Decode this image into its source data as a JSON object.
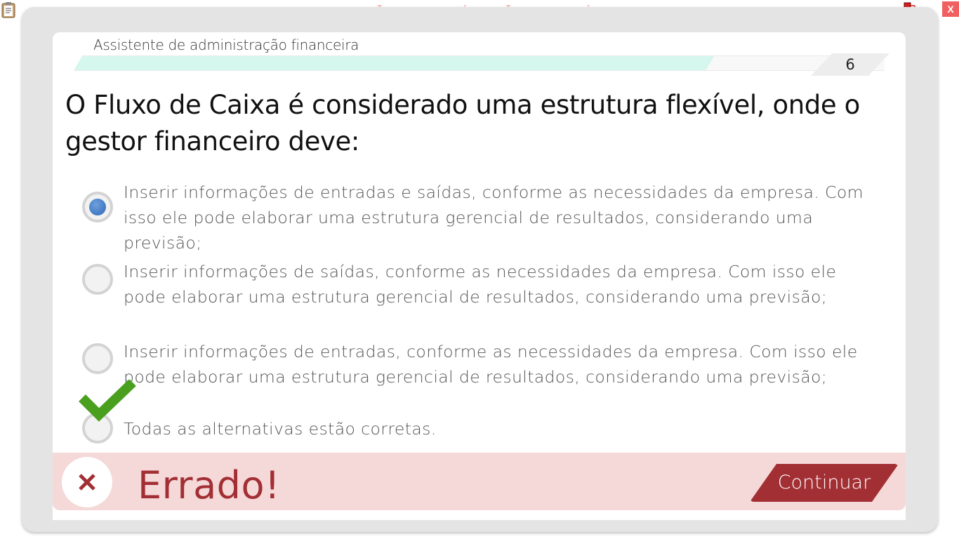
{
  "system": {
    "watermark": "VERSÃO PARA FUNCIONÁRIOS - NÃO COMERCIALIZÁVEL",
    "close_label": "X",
    "icons": [
      "clipboard-icon",
      "network-icon"
    ]
  },
  "header": {
    "course_title": "Assistente de administração financeira",
    "progress_fraction": 0.79,
    "page_number": "6"
  },
  "question": {
    "text": "O Fluxo de Caixa é considerado uma estrutura flexível, onde o gestor financeiro deve:"
  },
  "options": [
    {
      "text": "Inserir informações de entradas e saídas, conforme as necessidades da empresa. Com isso ele pode elaborar uma estrutura gerencial de resultados, considerando uma previsão;",
      "selected": true,
      "correct": false
    },
    {
      "text": "Inserir informações de saídas, conforme as necessidades da empresa. Com isso ele pode elaborar uma estrutura gerencial de resultados, considerando uma previsão;",
      "selected": false,
      "correct": false
    },
    {
      "text": "Inserir informações de entradas, conforme as necessidades da empresa. Com isso ele pode elaborar uma estrutura gerencial de resultados, considerando uma previsão;",
      "selected": false,
      "correct": false
    },
    {
      "text": "Todas as alternativas estão corretas.",
      "selected": false,
      "correct": true
    }
  ],
  "feedback": {
    "result": "Errado!",
    "continue_label": "Continuar"
  },
  "colors": {
    "accent": "#a22f34",
    "feedback_background": "#f5d8d8",
    "progress_fill": "#d6f7ee",
    "correct_check": "#4aa01e",
    "selected_radio": "#2f69b8",
    "watermark": "#f07070"
  }
}
